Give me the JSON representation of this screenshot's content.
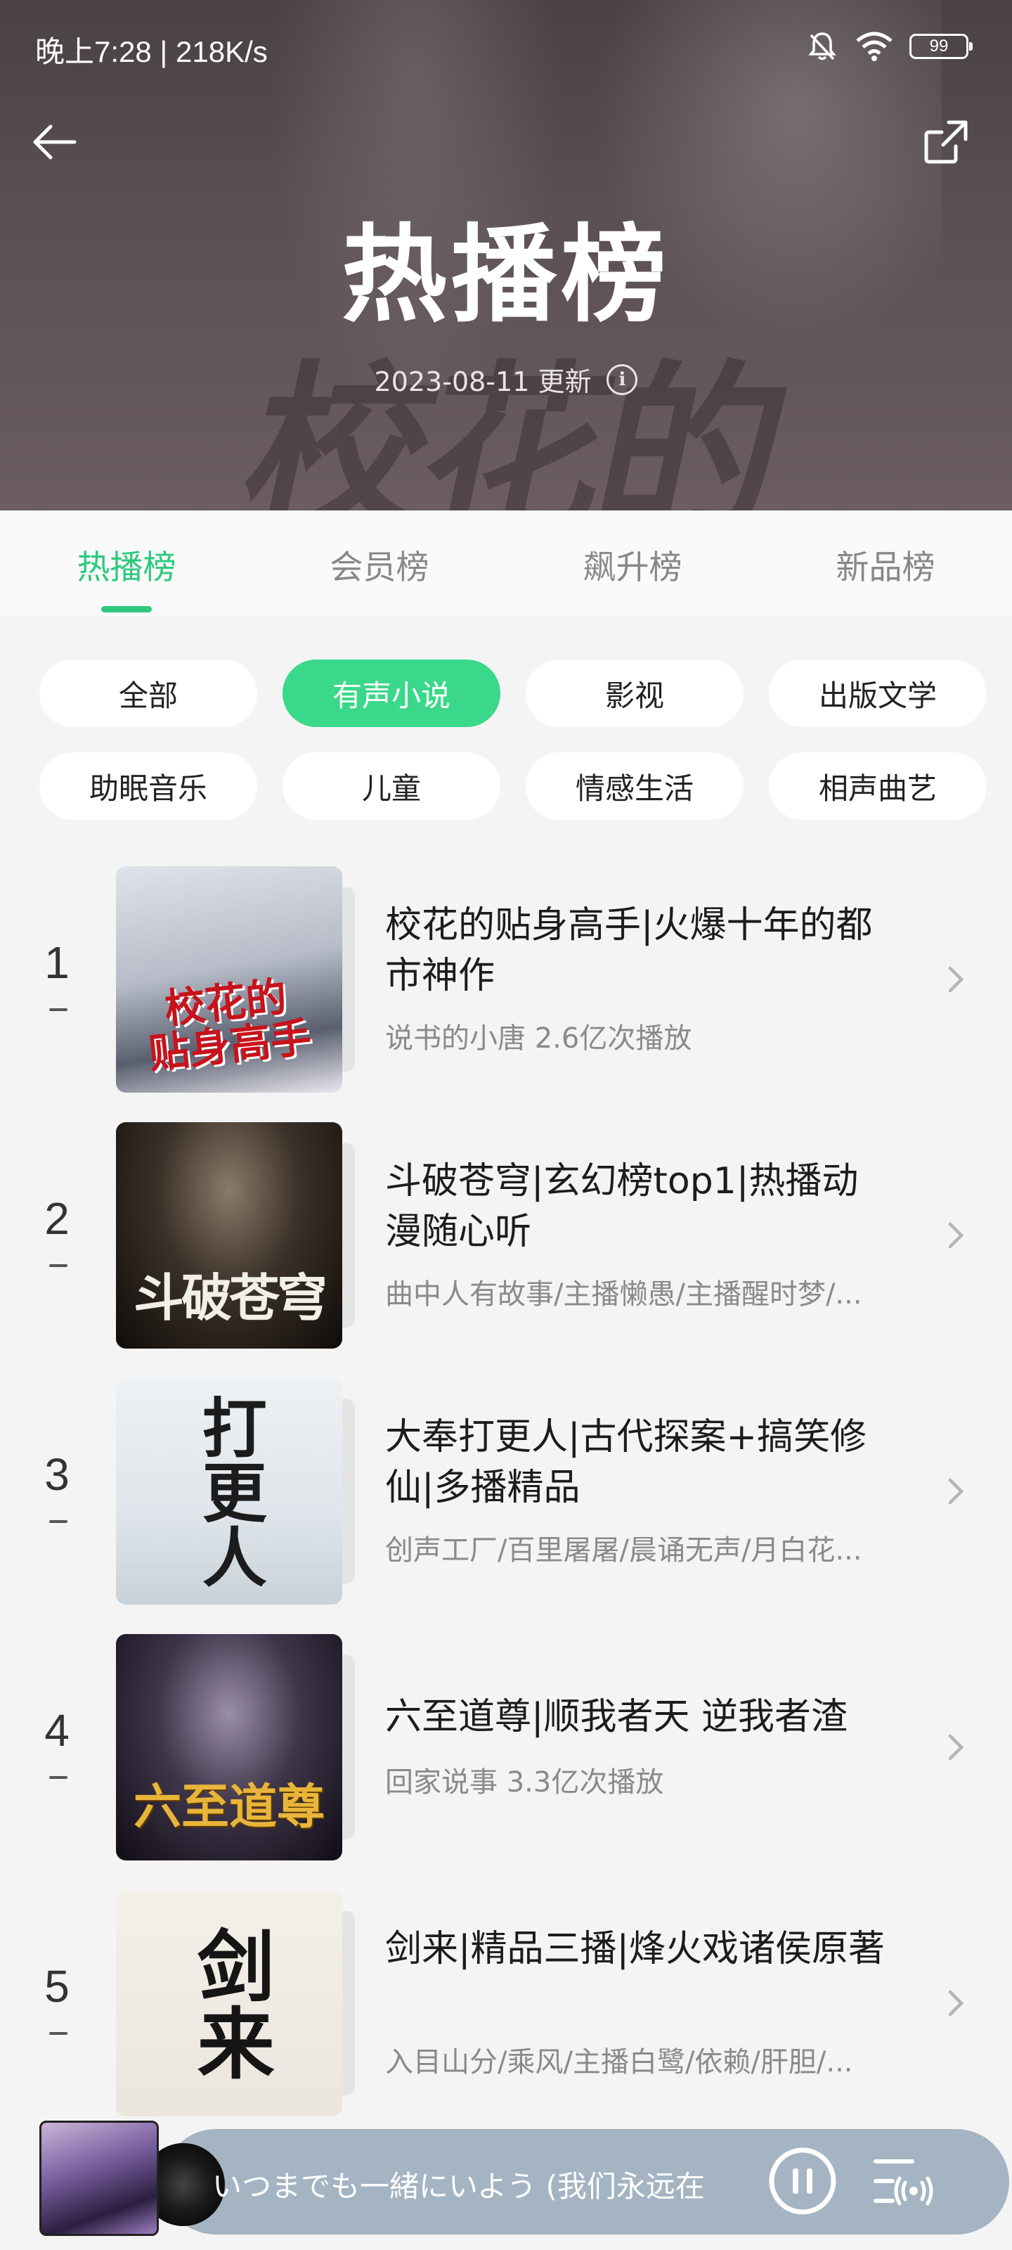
{
  "status_bar": {
    "time": "晚上7:28 | 218K/s",
    "battery": "99"
  },
  "hero": {
    "title": "热播榜",
    "update_text": "2023-08-11 更新",
    "background_art_text": "校花的"
  },
  "tabs": [
    {
      "label": "热播榜",
      "active": true
    },
    {
      "label": "会员榜",
      "active": false
    },
    {
      "label": "飙升榜",
      "active": false
    },
    {
      "label": "新品榜",
      "active": false
    }
  ],
  "chips": [
    {
      "label": "全部",
      "active": false
    },
    {
      "label": "有声小说",
      "active": true
    },
    {
      "label": "影视",
      "active": false
    },
    {
      "label": "出版文学",
      "active": false
    },
    {
      "label": "助眠音乐",
      "active": false
    },
    {
      "label": "儿童",
      "active": false
    },
    {
      "label": "情感生活",
      "active": false
    },
    {
      "label": "相声曲艺",
      "active": false
    }
  ],
  "list": [
    {
      "rank": "1",
      "title": "校花的贴身高手|火爆十年的都市神作",
      "subtitle": "说书的小唐  2.6亿次播放",
      "cover_text": "校花的\n贴身高手"
    },
    {
      "rank": "2",
      "title": "斗破苍穹|玄幻榜top1|热播动漫随心听",
      "subtitle": "曲中人有故事/主播懒愚/主播醒时梦/...",
      "cover_text": "斗破苍穹"
    },
    {
      "rank": "3",
      "title": "大奉打更人|古代探案+搞笑修仙|多播精品",
      "subtitle": "创声工厂/百里屠屠/晨诵无声/月白花...",
      "cover_text": "打更人"
    },
    {
      "rank": "4",
      "title": "六至道尊|顺我者天 逆我者渣",
      "subtitle": "回家说事  3.3亿次播放",
      "cover_text": "六至道尊"
    },
    {
      "rank": "5",
      "title": "剑来|精品三播|烽火戏诸侯原著",
      "subtitle": "入目山分/乘风/主播白鹭/依赖/肝胆/...",
      "cover_text": "剑来"
    }
  ],
  "player": {
    "track": "いつまでも一緒にいよう (我们永远在"
  },
  "colors": {
    "accent": "#2ec97e",
    "chip_active": "#3ad88a"
  }
}
